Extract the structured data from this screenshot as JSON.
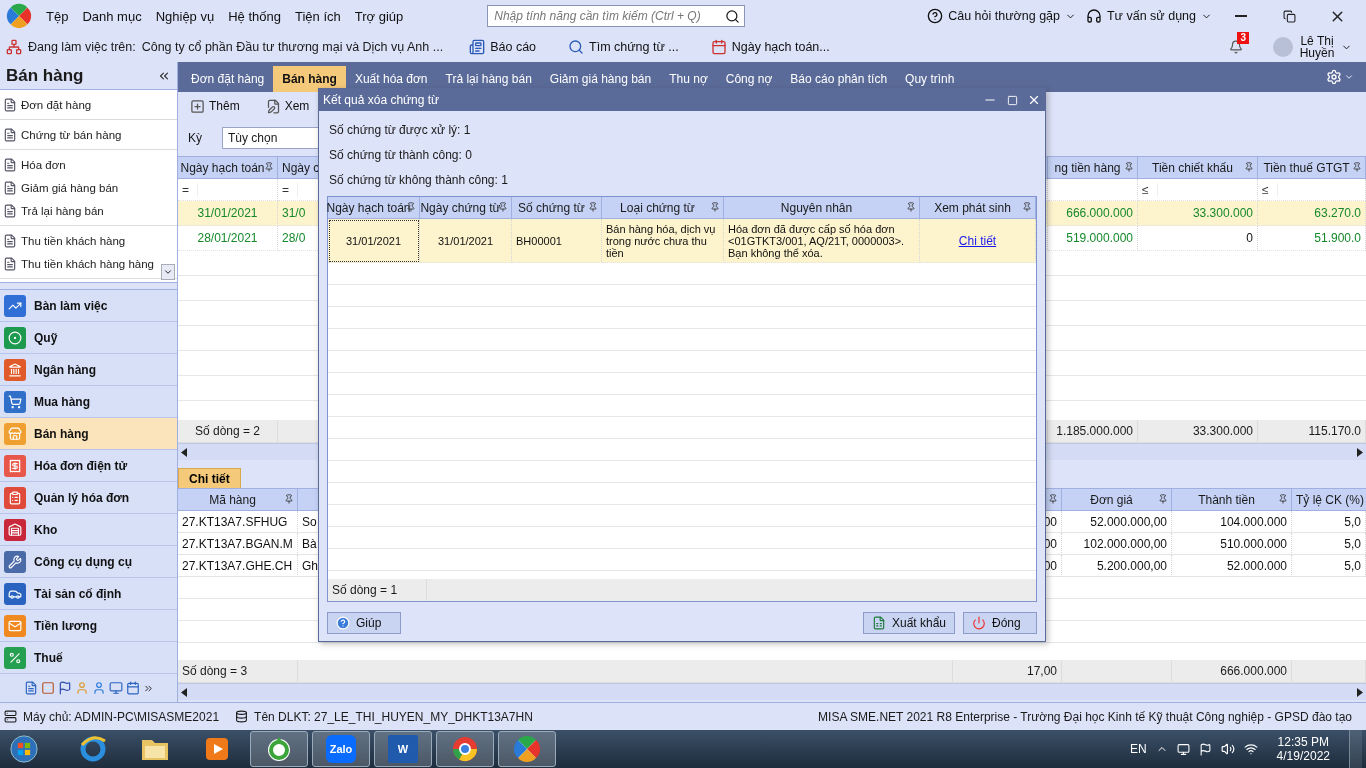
{
  "menu_bar": {
    "items": [
      "Tệp",
      "Danh mục",
      "Nghiệp vụ",
      "Hệ thống",
      "Tiện ích",
      "Trợ giúp"
    ],
    "search": {
      "placeholder": "Nhập tính năng cần tìm kiếm (Ctrl + Q)"
    },
    "help_links": [
      "Câu hỏi thường gặp",
      "Tư vấn sử dụng"
    ]
  },
  "work_bar": {
    "label": "Đang làm việc trên:",
    "company": "Công ty cổ phần Đầu tư thương mại và Dịch vụ Anh ...",
    "links": [
      "Báo cáo",
      "Tìm chứng từ ...",
      "Ngày hạch toán..."
    ],
    "notification_count": "3",
    "user": "Lê Thị Huyền"
  },
  "sidebar": {
    "title": "Bán hàng",
    "shortcut_groups": [
      [
        "Đơn đặt hàng"
      ],
      [
        "Chứng từ bán hàng"
      ],
      [
        "Hóa đơn",
        "Giảm giá hàng bán",
        "Trả lại hàng bán"
      ],
      [
        "Thu tiền khách hàng",
        "Thu tiền khách hàng hàng"
      ]
    ],
    "modules": [
      {
        "label": "Bàn làm việc",
        "selected": false
      },
      {
        "label": "Quỹ",
        "selected": false
      },
      {
        "label": "Ngân hàng",
        "selected": false
      },
      {
        "label": "Mua hàng",
        "selected": false
      },
      {
        "label": "Bán hàng",
        "selected": true
      },
      {
        "label": "Hóa đơn điện tử",
        "selected": false
      },
      {
        "label": "Quản lý hóa đơn",
        "selected": false
      },
      {
        "label": "Kho",
        "selected": false
      },
      {
        "label": "Công cụ dụng cụ",
        "selected": false
      },
      {
        "label": "Tài sản cố định",
        "selected": false
      },
      {
        "label": "Tiền lương",
        "selected": false
      },
      {
        "label": "Thuế",
        "selected": false
      }
    ]
  },
  "tabs": [
    {
      "label": "Đơn đặt hàng",
      "selected": false
    },
    {
      "label": "Bán hàng",
      "selected": true
    },
    {
      "label": "Xuất hóa đơn",
      "selected": false
    },
    {
      "label": "Trả lại hàng bán",
      "selected": false
    },
    {
      "label": "Giảm giá hàng bán",
      "selected": false
    },
    {
      "label": "Thu nợ",
      "selected": false
    },
    {
      "label": "Công nợ",
      "selected": false
    },
    {
      "label": "Báo cáo phân tích",
      "selected": false
    },
    {
      "label": "Quy trình",
      "selected": false
    }
  ],
  "toolbar": [
    "Thêm",
    "Xem"
  ],
  "period": {
    "label": "Kỳ",
    "value": "Tùy chọn"
  },
  "upper_grid": {
    "columns": [
      "Ngày hạch toán",
      "Ngày c",
      "ng tiền hàng",
      "Tiền chiết khấu",
      "Tiền thuế GTGT"
    ],
    "filter_operators": {
      "column_1": "=",
      "column_2": "=",
      "discount": "≤",
      "vat": "≤"
    },
    "rows": [
      {
        "cells": [
          "31/01/2021",
          "31/0",
          "666.000.000",
          "33.300.000",
          "63.270.0"
        ],
        "selected": true
      },
      {
        "cells": [
          "28/01/2021",
          "28/0",
          "519.000.000",
          "0",
          "51.900.0"
        ],
        "selected": false
      }
    ],
    "footer": {
      "row_count": "Số dòng = 2",
      "amount": "1.185.000.000",
      "discount": "33.300.000",
      "vat": "115.170.0"
    }
  },
  "detail_tab": "Chi tiết",
  "lower_grid": {
    "columns": {
      "code": "Mã hàng",
      "unit_price": "Đơn giá",
      "amount": "Thành tiền",
      "discount_rate": "Tỷ lệ CK (%)"
    },
    "rows": [
      {
        "cells": [
          "27.KT13A7.SFHUG",
          "So",
          "00",
          "52.000.000,00",
          "104.000.000",
          "5,0"
        ]
      },
      {
        "cells": [
          "27.KT13A7.BGAN.M",
          "Bà",
          "00",
          "102.000.000,00",
          "510.000.000",
          "5,0"
        ]
      },
      {
        "cells": [
          "27.KT13A7.GHE.CH",
          "Gh",
          "00",
          "5.200.000,00",
          "52.000.000",
          "5,0"
        ]
      }
    ],
    "footer": {
      "row_count": "Số dòng = 3",
      "quantity": "17,00",
      "amount": "666.000.000"
    }
  },
  "dialog": {
    "title": "Kết quả xóa chứng từ",
    "summary": [
      "Số chứng từ được xử lý: 1",
      "Số chứng từ thành công: 0",
      "Số chứng từ không thành công: 1"
    ],
    "columns": [
      "Ngày hạch toán",
      "Ngày chứng từ",
      "Số chứng từ",
      "Loại chứng từ",
      "Nguyên nhân",
      "Xem phát sinh"
    ],
    "rows": [
      {
        "posting_date": "31/01/2021",
        "voucher_date": "31/01/2021",
        "voucher_no": "BH00001",
        "voucher_type": "Bán hàng hóa, dịch vụ trong nước chưa thu tiền",
        "reason": "Hóa đơn đã được cấp số hóa đơn <01GTKT3/001, AQ/21T, 0000003>. Bạn không thể xóa.",
        "link": "Chi tiết",
        "selected": true
      }
    ],
    "footer": "Số dòng = 1",
    "buttons": {
      "help": "Giúp",
      "export": "Xuất khẩu",
      "close": "Đóng"
    }
  },
  "status_bar": {
    "server": "Máy chủ: ADMIN-PC\\MISASME2021",
    "database": "Tên DLKT: 27_LE_THI_HUYEN_MY_DHKT13A7HN",
    "product": "MISA SME.NET 2021 R8 Enterprise - Trường Đại học Kinh tế Kỹ thuật Công nghiệp - GPSD đào tạo"
  },
  "taskbar": {
    "apps": [
      {
        "kind": "browser"
      },
      {
        "kind": "folder"
      },
      {
        "kind": "player"
      },
      {
        "kind": "coccoc"
      },
      {
        "kind": "chat",
        "label": "Zalo"
      },
      {
        "kind": "word",
        "label": "W"
      },
      {
        "kind": "chrome"
      },
      {
        "kind": "misa"
      }
    ],
    "language": "EN",
    "time": "12:35 PM",
    "date": "4/19/2022"
  }
}
